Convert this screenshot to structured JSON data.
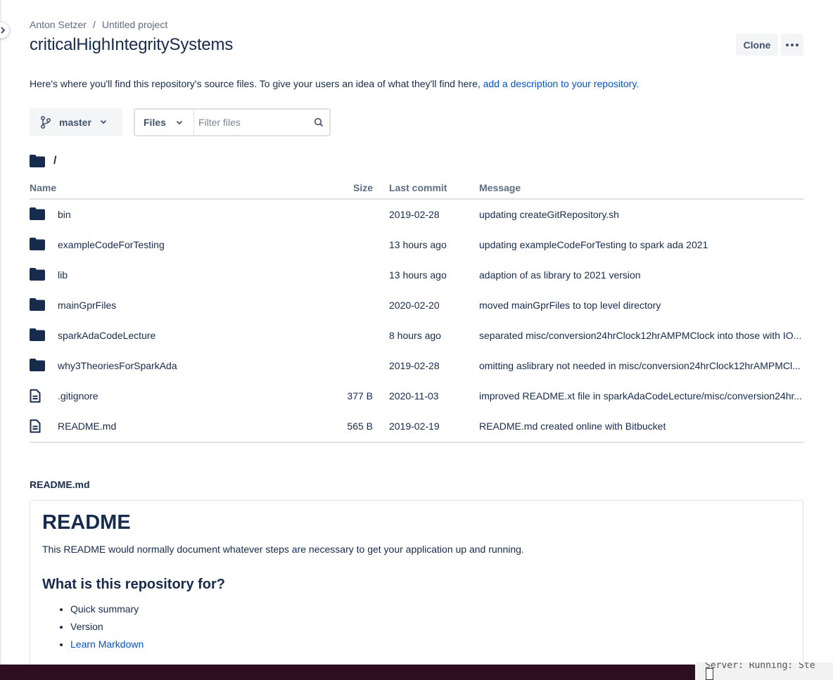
{
  "breadcrumb": {
    "owner": "Anton Setzer",
    "separator": "/",
    "project": "Untitled project"
  },
  "page_title": "criticalHighIntegritySystems",
  "actions": {
    "clone_label": "Clone",
    "more_icon": "more-horizontal-icon"
  },
  "description": {
    "text": "Here's where you'll find this repository's source files. To give your users an idea of what they'll find here,",
    "link": "add a description to your repository."
  },
  "branch": {
    "label": "master",
    "icon": "branch-icon"
  },
  "filter": {
    "mode_label": "Files",
    "placeholder": "Filter files"
  },
  "path": {
    "current": "/"
  },
  "table": {
    "headers": {
      "name": "Name",
      "size": "Size",
      "last_commit": "Last commit",
      "message": "Message"
    },
    "rows": [
      {
        "type": "folder",
        "name": "bin",
        "size": "",
        "date": "2019-02-28",
        "message": "updating createGitRepository.sh"
      },
      {
        "type": "folder",
        "name": "exampleCodeForTesting",
        "size": "",
        "date": "13 hours ago",
        "message": "updating exampleCodeForTesting to spark ada 2021"
      },
      {
        "type": "folder",
        "name": "lib",
        "size": "",
        "date": "13 hours ago",
        "message": "adaption of as library to 2021 version"
      },
      {
        "type": "folder",
        "name": "mainGprFiles",
        "size": "",
        "date": "2020-02-20",
        "message": "moved mainGprFiles to top level directory"
      },
      {
        "type": "folder",
        "name": "sparkAdaCodeLecture",
        "size": "",
        "date": "8 hours ago",
        "message": "separated misc/conversion24hrClock12hrAMPMClock into those with IO..."
      },
      {
        "type": "folder",
        "name": "why3TheoriesForSparkAda",
        "size": "",
        "date": "2019-02-28",
        "message": "omitting aslibrary not needed in misc/conversion24hrClock12hrAMPMCl..."
      },
      {
        "type": "file",
        "name": ".gitignore",
        "size": "377 B",
        "date": "2020-11-03",
        "message": "improved README.xt file in sparkAdaCodeLecture/misc/conversion24hr..."
      },
      {
        "type": "file",
        "name": "README.md",
        "size": "565 B",
        "date": "2019-02-19",
        "message": "README.md created online with Bitbucket"
      }
    ]
  },
  "readme": {
    "label": "README.md",
    "h1": "README",
    "intro": "This README would normally document whatever steps are necessary to get your application up and running.",
    "h2": "What is this repository for?",
    "items": [
      "Quick summary",
      "Version",
      "Learn Markdown"
    ]
  },
  "terminal": {
    "snippet": "Server: Running: Ste"
  },
  "colors": {
    "text": "#172b4d",
    "muted": "#5e6c84",
    "link": "#0052cc",
    "button_bg": "#f4f5f7",
    "border": "#dfe1e6"
  }
}
